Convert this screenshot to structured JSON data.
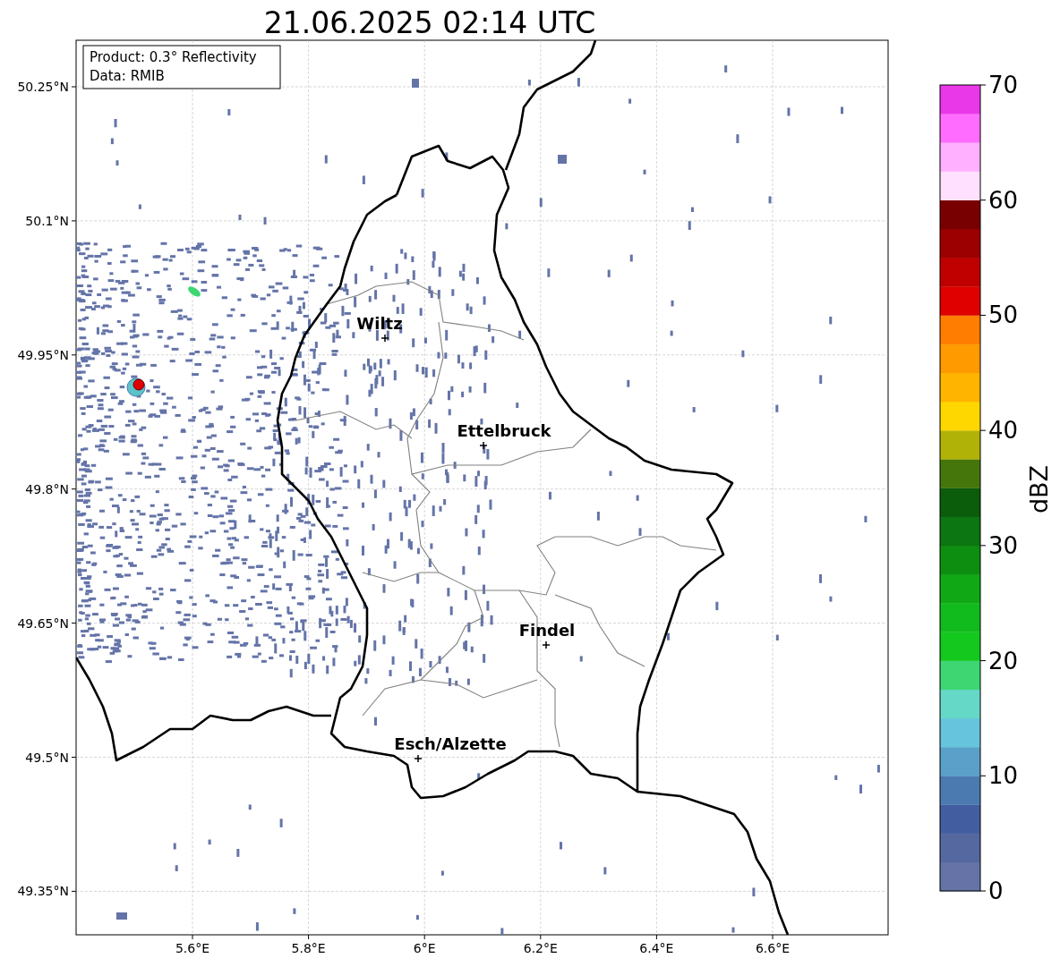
{
  "title": "21.06.2025 02:14 UTC",
  "map": {
    "info_box": [
      "Product: 0.3° Reflectivity",
      "Data: RMIB"
    ],
    "lat_ticks": [
      "50.25°N",
      "50.1°N",
      "49.95°N",
      "49.8°N",
      "49.65°N",
      "49.5°N",
      "49.35°N"
    ],
    "lon_ticks": [
      "5.6°E",
      "5.8°E",
      "6°E",
      "6.2°E",
      "6.4°E",
      "6.6°E"
    ],
    "cities": [
      {
        "name": "Wiltz"
      },
      {
        "name": "Ettelbruck"
      },
      {
        "name": "Findel"
      },
      {
        "name": "Esch/Alzette"
      }
    ]
  },
  "colorbar": {
    "label": "dBZ",
    "ticks": [
      "70",
      "60",
      "50",
      "40",
      "30",
      "20",
      "10",
      "0"
    ],
    "bins": [
      {
        "color": "#6673a6"
      },
      {
        "color": "#5568a0"
      },
      {
        "color": "#435ea0"
      },
      {
        "color": "#4a7ab0"
      },
      {
        "color": "#5aa0c8"
      },
      {
        "color": "#66c4dc"
      },
      {
        "color": "#66d8c8"
      },
      {
        "color": "#3ed673"
      },
      {
        "color": "#14c81e"
      },
      {
        "color": "#12bb1d"
      },
      {
        "color": "#10a815"
      },
      {
        "color": "#0e8e10"
      },
      {
        "color": "#0c7612"
      },
      {
        "color": "#0b5c0b"
      },
      {
        "color": "#44760c"
      },
      {
        "color": "#b0b208"
      },
      {
        "color": "#ffd700"
      },
      {
        "color": "#ffb400"
      },
      {
        "color": "#ff9a00"
      },
      {
        "color": "#ff7d00"
      },
      {
        "color": "#e00000"
      },
      {
        "color": "#c00000"
      },
      {
        "color": "#9c0000"
      },
      {
        "color": "#780000"
      },
      {
        "color": "#ffe0ff"
      },
      {
        "color": "#ffb0ff"
      },
      {
        "color": "#ff6cff"
      },
      {
        "color": "#e838e8"
      }
    ]
  }
}
